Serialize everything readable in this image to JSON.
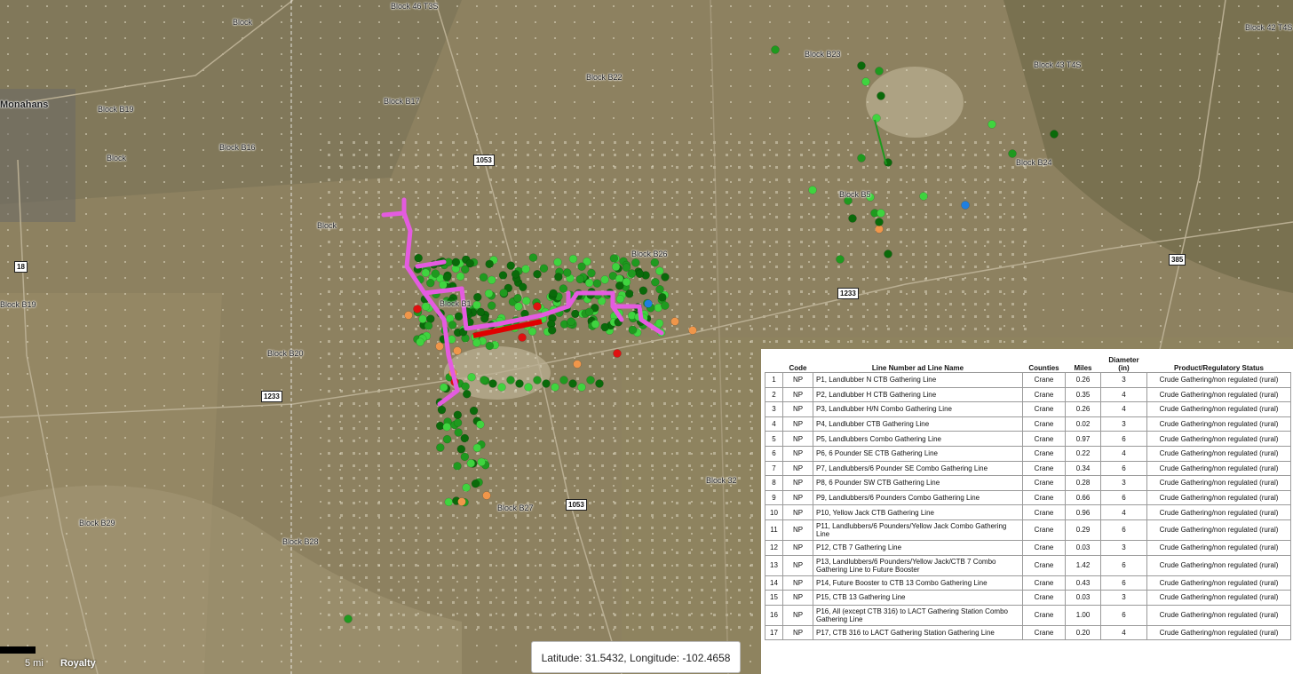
{
  "map": {
    "labels": [
      "Block 46 T3S",
      "Block",
      "Monahans",
      "Block B19",
      "Block",
      "Block B16",
      "Block B17",
      "Block B22",
      "Block B23",
      "Block 43 T4S",
      "Block 42 T4S",
      "Block B24",
      "Block B5",
      "Block",
      "Block B26",
      "Block B1",
      "Block B20",
      "Block B27",
      "Block 32",
      "Block B29",
      "Block B28",
      "Block B19",
      "Royalty"
    ],
    "shields": [
      "1053",
      "18",
      "1233",
      "1233",
      "385",
      "1053"
    ],
    "coords_readout": "Latitude: 31.5432, Longitude: -102.4658",
    "scale_label": "5 mi",
    "colors": {
      "gathering_line": "#e45be0",
      "red_line": "#e00000",
      "well_green": "#1f9a1f",
      "well_dark": "#0a6a0a",
      "well_light": "#3fd43f",
      "well_orange": "#f0964a",
      "well_red": "#e01010",
      "well_blue": "#1e7fe0"
    }
  },
  "table": {
    "headers": {
      "num": "",
      "code": "Code",
      "name": "Line Number ad Line Name",
      "counties": "Counties",
      "miles": "Miles",
      "diameter": "Diameter (in)",
      "status": "Product/Regulatory Status"
    },
    "rows": [
      {
        "n": "1",
        "code": "NP",
        "name": "P1, Landlubber N CTB Gathering Line",
        "county": "Crane",
        "miles": "0.26",
        "dia": "3",
        "status": "Crude Gathering/non regulated (rural)"
      },
      {
        "n": "2",
        "code": "NP",
        "name": "P2, Landlubber H CTB Gathering Line",
        "county": "Crane",
        "miles": "0.35",
        "dia": "4",
        "status": "Crude Gathering/non regulated (rural)"
      },
      {
        "n": "3",
        "code": "NP",
        "name": "P3, Landlubber H/N Combo Gathering Line",
        "county": "Crane",
        "miles": "0.26",
        "dia": "4",
        "status": "Crude Gathering/non regulated (rural)"
      },
      {
        "n": "4",
        "code": "NP",
        "name": "P4, Landlubber CTB Gathering Line",
        "county": "Crane",
        "miles": "0.02",
        "dia": "3",
        "status": "Crude Gathering/non regulated (rural)"
      },
      {
        "n": "5",
        "code": "NP",
        "name": "P5, Landlubbers Combo Gathering Line",
        "county": "Crane",
        "miles": "0.97",
        "dia": "6",
        "status": "Crude Gathering/non regulated (rural)"
      },
      {
        "n": "6",
        "code": "NP",
        "name": "P6, 6 Pounder SE CTB Gathering Line",
        "county": "Crane",
        "miles": "0.22",
        "dia": "4",
        "status": "Crude Gathering/non regulated (rural)"
      },
      {
        "n": "7",
        "code": "NP",
        "name": "P7, Landlubbers/6 Pounder SE Combo Gathering Line",
        "county": "Crane",
        "miles": "0.34",
        "dia": "6",
        "status": "Crude Gathering/non regulated (rural)"
      },
      {
        "n": "8",
        "code": "NP",
        "name": "P8, 6 Pounder SW CTB Gathering Line",
        "county": "Crane",
        "miles": "0.28",
        "dia": "3",
        "status": "Crude Gathering/non regulated (rural)"
      },
      {
        "n": "9",
        "code": "NP",
        "name": "P9, Landlubbers/6 Pounders Combo Gathering Line",
        "county": "Crane",
        "miles": "0.66",
        "dia": "6",
        "status": "Crude Gathering/non regulated (rural)"
      },
      {
        "n": "10",
        "code": "NP",
        "name": "P10, Yellow Jack CTB Gathering Line",
        "county": "Crane",
        "miles": "0.96",
        "dia": "4",
        "status": "Crude Gathering/non regulated (rural)"
      },
      {
        "n": "11",
        "code": "NP",
        "name": "P11, Landlubbers/6 Pounders/Yellow Jack Combo Gathering Line",
        "county": "Crane",
        "miles": "0.29",
        "dia": "6",
        "status": "Crude Gathering/non regulated (rural)"
      },
      {
        "n": "12",
        "code": "NP",
        "name": "P12, CTB 7 Gathering Line",
        "county": "Crane",
        "miles": "0.03",
        "dia": "3",
        "status": "Crude Gathering/non regulated (rural)"
      },
      {
        "n": "13",
        "code": "NP",
        "name": "P13, Landlubbers/6 Pounders/Yellow Jack/CTB 7 Combo Gathering Line to Future Booster",
        "county": "Crane",
        "miles": "1.42",
        "dia": "6",
        "status": "Crude Gathering/non regulated (rural)"
      },
      {
        "n": "14",
        "code": "NP",
        "name": "P14, Future Booster to CTB 13 Combo Gathering Line",
        "county": "Crane",
        "miles": "0.43",
        "dia": "6",
        "status": "Crude Gathering/non regulated (rural)"
      },
      {
        "n": "15",
        "code": "NP",
        "name": "P15, CTB 13 Gathering Line",
        "county": "Crane",
        "miles": "0.03",
        "dia": "3",
        "status": "Crude Gathering/non regulated (rural)"
      },
      {
        "n": "16",
        "code": "NP",
        "name": "P16, All (except CTB 316) to LACT Gathering Station Combo Gathering Line",
        "county": "Crane",
        "miles": "1.00",
        "dia": "6",
        "status": "Crude Gathering/non regulated (rural)"
      },
      {
        "n": "17",
        "code": "NP",
        "name": "P17, CTB 316 to LACT Gathering Station Gathering Line",
        "county": "Crane",
        "miles": "0.20",
        "dia": "4",
        "status": "Crude Gathering/non regulated (rural)"
      }
    ]
  }
}
